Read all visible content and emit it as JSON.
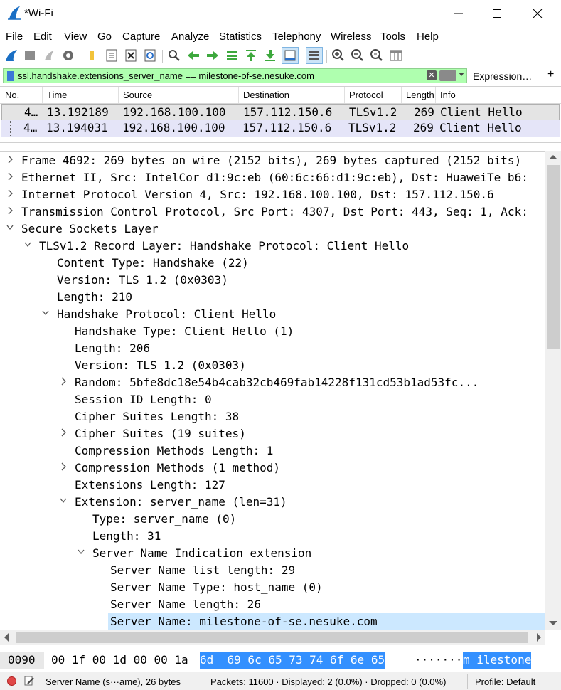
{
  "window": {
    "title": "*Wi-Fi",
    "controls": [
      "minimize",
      "maximize",
      "close"
    ]
  },
  "menu": [
    "File",
    "Edit",
    "View",
    "Go",
    "Capture",
    "Analyze",
    "Statistics",
    "Telephony",
    "Wireless",
    "Tools",
    "Help"
  ],
  "toolbar": {
    "icons": [
      "shark-fin-icon",
      "stop-icon",
      "restart-icon",
      "options-gear-icon",
      "open-folder-icon",
      "save-file-icon",
      "close-file-icon",
      "reload-icon",
      "find-icon",
      "back-arrow-icon",
      "forward-arrow-icon",
      "goto-packet-icon",
      "first-packet-icon",
      "last-packet-icon",
      "autoscroll-icon",
      "colorize-icon",
      "zoom-in-icon",
      "zoom-out-icon",
      "zoom-normal-icon",
      "resize-columns-icon"
    ]
  },
  "filter": {
    "value": "ssl.handshake.extensions_server_name == milestone-of-se.nesuke.com",
    "expression_label": "Expression…",
    "plus_label": "+",
    "clear_label": "✕",
    "color": "#afffaf"
  },
  "packet_list": {
    "columns": [
      "No.",
      "Time",
      "Source",
      "Destination",
      "Protocol",
      "Length",
      "Info"
    ],
    "rows": [
      {
        "no": "4…",
        "time": "13.192189",
        "source": "192.168.100.100",
        "destination": "157.112.150.6",
        "protocol": "TLSv1.2",
        "length": "269",
        "info": "Client Hello",
        "selected": true
      },
      {
        "no": "4…",
        "time": "13.194031",
        "source": "192.168.100.100",
        "destination": "157.112.150.6",
        "protocol": "TLSv1.2",
        "length": "269",
        "info": "Client Hello",
        "selected": false
      }
    ]
  },
  "details": [
    {
      "text": "Frame 4692: 269 bytes on wire (2152 bits), 269 bytes captured (2152 bits)",
      "indent": 0,
      "arrow": "collapsed"
    },
    {
      "text": "Ethernet II, Src: IntelCor_d1:9c:eb (60:6c:66:d1:9c:eb), Dst: HuaweiTe_b6:",
      "indent": 0,
      "arrow": "collapsed"
    },
    {
      "text": "Internet Protocol Version 4, Src: 192.168.100.100, Dst: 157.112.150.6",
      "indent": 0,
      "arrow": "collapsed"
    },
    {
      "text": "Transmission Control Protocol, Src Port: 4307, Dst Port: 443, Seq: 1, Ack:",
      "indent": 0,
      "arrow": "collapsed"
    },
    {
      "text": "Secure Sockets Layer",
      "indent": 0,
      "arrow": "expanded"
    },
    {
      "text": "TLSv1.2 Record Layer: Handshake Protocol: Client Hello",
      "indent": 1,
      "arrow": "expanded"
    },
    {
      "text": "Content Type: Handshake (22)",
      "indent": 2,
      "arrow": "none"
    },
    {
      "text": "Version: TLS 1.2 (0x0303)",
      "indent": 2,
      "arrow": "none"
    },
    {
      "text": "Length: 210",
      "indent": 2,
      "arrow": "none"
    },
    {
      "text": "Handshake Protocol: Client Hello",
      "indent": 2,
      "arrow": "expanded"
    },
    {
      "text": "Handshake Type: Client Hello (1)",
      "indent": 3,
      "arrow": "none"
    },
    {
      "text": "Length: 206",
      "indent": 3,
      "arrow": "none"
    },
    {
      "text": "Version: TLS 1.2 (0x0303)",
      "indent": 3,
      "arrow": "none"
    },
    {
      "text": "Random: 5bfe8dc18e54b4cab32cb469fab14228f131cd53b1ad53fc...",
      "indent": 3,
      "arrow": "collapsed"
    },
    {
      "text": "Session ID Length: 0",
      "indent": 3,
      "arrow": "none"
    },
    {
      "text": "Cipher Suites Length: 38",
      "indent": 3,
      "arrow": "none"
    },
    {
      "text": "Cipher Suites (19 suites)",
      "indent": 3,
      "arrow": "collapsed"
    },
    {
      "text": "Compression Methods Length: 1",
      "indent": 3,
      "arrow": "none"
    },
    {
      "text": "Compression Methods (1 method)",
      "indent": 3,
      "arrow": "collapsed"
    },
    {
      "text": "Extensions Length: 127",
      "indent": 3,
      "arrow": "none"
    },
    {
      "text": "Extension: server_name (len=31)",
      "indent": 3,
      "arrow": "expanded"
    },
    {
      "text": "Type: server_name (0)",
      "indent": 4,
      "arrow": "none"
    },
    {
      "text": "Length: 31",
      "indent": 4,
      "arrow": "none"
    },
    {
      "text": "Server Name Indication extension",
      "indent": 4,
      "arrow": "expanded"
    },
    {
      "text": "Server Name list length: 29",
      "indent": 5,
      "arrow": "none"
    },
    {
      "text": "Server Name Type: host_name (0)",
      "indent": 5,
      "arrow": "none"
    },
    {
      "text": "Server Name length: 26",
      "indent": 5,
      "arrow": "none"
    },
    {
      "text": "Server Name: milestone-of-se.nesuke.com",
      "indent": 5,
      "arrow": "none",
      "highlight": true
    }
  ],
  "bytes": {
    "offset": "0090",
    "hex_plain": "00 1f 00 1d 00 00 1a",
    "hex_selected": "6d  69 6c 65 73 74 6f 6e 65",
    "ascii_plain": "·······",
    "ascii_selected": "m ilestone"
  },
  "status": {
    "field": "Server Name (s···ame), 26 bytes",
    "packets": "Packets: 11600 · Displayed: 2 (0.0%) · Dropped: 0 (0.0%)",
    "profile": "Profile: Default"
  }
}
